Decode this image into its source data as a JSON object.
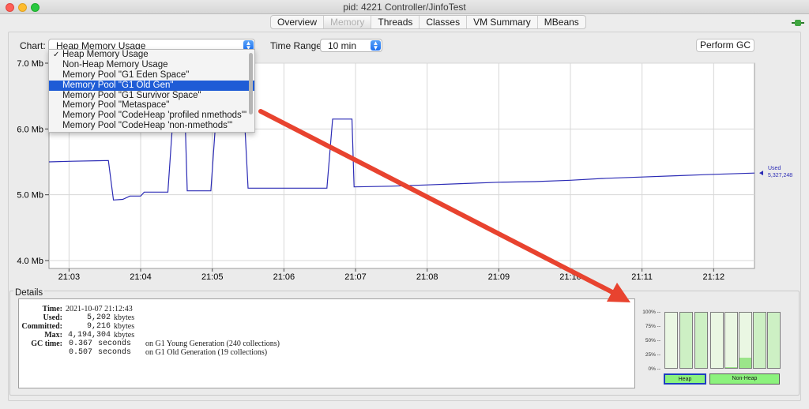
{
  "window": {
    "title": "pid: 4221 Controller/JinfoTest"
  },
  "tabs": [
    {
      "label": "Overview",
      "active": false
    },
    {
      "label": "Memory",
      "active": true
    },
    {
      "label": "Threads",
      "active": false
    },
    {
      "label": "Classes",
      "active": false
    },
    {
      "label": "VM Summary",
      "active": false
    },
    {
      "label": "MBeans",
      "active": false
    }
  ],
  "toolbar": {
    "chart_label": "Chart:",
    "chart_value": "Heap Memory Usage",
    "time_range_label": "Time Range:",
    "time_range_value": "10 min",
    "perform_gc_label": "Perform GC"
  },
  "dropdown": {
    "items": [
      {
        "label": "Heap Memory Usage",
        "checked": true,
        "highlighted": false
      },
      {
        "label": "Non-Heap Memory Usage",
        "checked": false,
        "highlighted": false
      },
      {
        "label": "Memory Pool \"G1 Eden Space\"",
        "checked": false,
        "highlighted": false
      },
      {
        "label": "Memory Pool \"G1 Old Gen\"",
        "checked": false,
        "highlighted": true
      },
      {
        "label": "Memory Pool \"G1 Survivor Space\"",
        "checked": false,
        "highlighted": false
      },
      {
        "label": "Memory Pool \"Metaspace\"",
        "checked": false,
        "highlighted": false
      },
      {
        "label": "Memory Pool \"CodeHeap 'profiled nmethods'\"",
        "checked": false,
        "highlighted": false
      },
      {
        "label": "Memory Pool \"CodeHeap 'non-nmethods'\"",
        "checked": false,
        "highlighted": false
      }
    ]
  },
  "chart_data": {
    "type": "line",
    "title": "",
    "xlabel": "",
    "ylabel": "",
    "ylim": [
      4.0,
      7.0
    ],
    "yticks": [
      "4.0 Mb",
      "5.0 Mb",
      "6.0 Mb",
      "7.0 Mb"
    ],
    "xticks": [
      "21:03",
      "21:04",
      "21:05",
      "21:06",
      "21:07",
      "21:08",
      "21:09",
      "21:10",
      "21:11",
      "21:12"
    ],
    "xtick_minutes": [
      3,
      4,
      5,
      6,
      7,
      8,
      9,
      10,
      11,
      12
    ],
    "xlim_minutes": [
      2.72,
      12.57
    ],
    "grid": true,
    "series": [
      {
        "name": "Used",
        "color": "#2b2bb5",
        "value_label": "5,327,248",
        "points": [
          [
            2.72,
            5.5
          ],
          [
            3.05,
            5.51
          ],
          [
            3.55,
            5.52
          ],
          [
            3.62,
            4.92
          ],
          [
            3.75,
            4.93
          ],
          [
            3.85,
            4.98
          ],
          [
            4.0,
            4.98
          ],
          [
            4.05,
            5.04
          ],
          [
            4.38,
            5.04
          ],
          [
            4.45,
            6.15
          ],
          [
            4.62,
            6.15
          ],
          [
            4.65,
            5.06
          ],
          [
            4.98,
            5.06
          ],
          [
            5.05,
            6.15
          ],
          [
            5.45,
            6.15
          ],
          [
            5.5,
            5.1
          ],
          [
            6.6,
            5.1
          ],
          [
            6.68,
            6.15
          ],
          [
            6.95,
            6.15
          ],
          [
            6.98,
            5.12
          ],
          [
            7.5,
            5.13
          ],
          [
            8.0,
            5.15
          ],
          [
            8.5,
            5.17
          ],
          [
            9.0,
            5.19
          ],
          [
            9.5,
            5.2
          ],
          [
            10.0,
            5.22
          ],
          [
            10.5,
            5.25
          ],
          [
            11.0,
            5.27
          ],
          [
            11.5,
            5.29
          ],
          [
            12.0,
            5.31
          ],
          [
            12.57,
            5.33
          ]
        ]
      }
    ]
  },
  "details": {
    "title": "Details",
    "time_key": "Time:",
    "time_val": "2021-10-07 21:12:43",
    "used_key": "Used:",
    "used_num": "5,202",
    "used_unit": "kbytes",
    "committed_key": "Committed:",
    "committed_num": "9,216",
    "committed_unit": "kbytes",
    "max_key": "Max:",
    "max_num": "4,194,304",
    "max_unit": "kbytes",
    "gc_key": "GC time:",
    "gc1_num": "0.367",
    "gc1_text": "seconds",
    "gc1_desc": "on G1 Young Generation (240 collections)",
    "gc2_num": "0.507",
    "gc2_text": "seconds",
    "gc2_desc": "on G1 Old Generation (19 collections)"
  },
  "pool_bars": {
    "scale": [
      "100% --",
      "75% --",
      "50% --",
      "25% --",
      "0% --"
    ],
    "heap_label": "Heap",
    "nonheap_label": "Non-Heap",
    "heap_levels": [
      0,
      1.0,
      1.0
    ],
    "nonheap_levels": [
      0,
      0.02,
      0.18,
      1.0,
      1.0
    ]
  },
  "colors": {
    "accent": "#1f5cd6",
    "arrow": "#e8432f",
    "series": "#2b2bb5",
    "bar_fill": "#8cf27d"
  }
}
